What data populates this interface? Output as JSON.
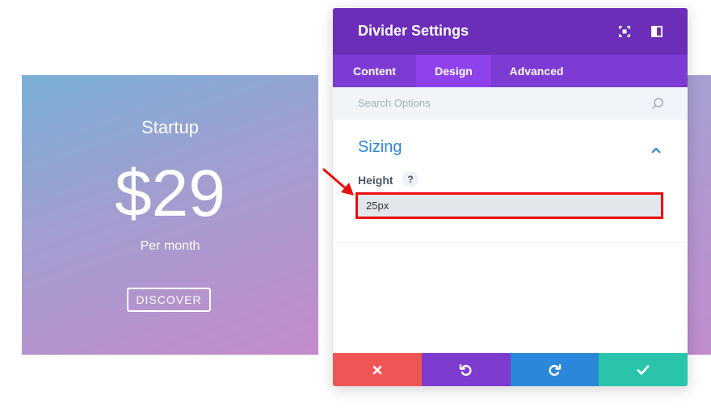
{
  "preview_card": {
    "title": "Startup",
    "price": "$29",
    "period": "Per month",
    "button_label": "DISCOVER"
  },
  "modal": {
    "title": "Divider Settings",
    "tabs": [
      {
        "label": "Content"
      },
      {
        "label": "Design"
      },
      {
        "label": "Advanced"
      }
    ],
    "active_tab": "Design",
    "search": {
      "placeholder": "Search Options"
    },
    "section": {
      "title": "Sizing",
      "field_label": "Height",
      "help_label": "?",
      "height_value": "25px"
    }
  },
  "icons": {
    "expand": "expand-icon",
    "split": "sidebar-toggle-icon",
    "search": "search-icon",
    "collapse": "chevron-up-icon",
    "cancel": "close-icon",
    "undo": "undo-icon",
    "redo": "redo-icon",
    "save": "checkmark-icon"
  },
  "colors": {
    "header": "#6c2eb9",
    "tabs": "#7d3bd4",
    "active_tab": "#8f42ec",
    "accent_blue": "#2b87da",
    "cancel": "#ef5555",
    "save": "#29c4a9",
    "annotation_red": "#ea0f0f"
  }
}
